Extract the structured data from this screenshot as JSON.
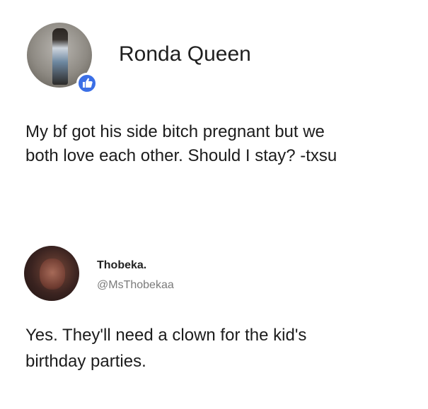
{
  "posts": [
    {
      "author": "Ronda Queen",
      "lines": [
        "My bf got his side bitch pregnant but we",
        "both love each other. Should I stay? -txsu"
      ],
      "badge_icon": "thumbs-up-icon",
      "badge_color": "#3b6fe6"
    },
    {
      "author": "Thobeka.",
      "handle": "@MsThobekaa",
      "lines": [
        "Yes. They'll need a clown for the kid's",
        "birthday parties."
      ]
    }
  ]
}
